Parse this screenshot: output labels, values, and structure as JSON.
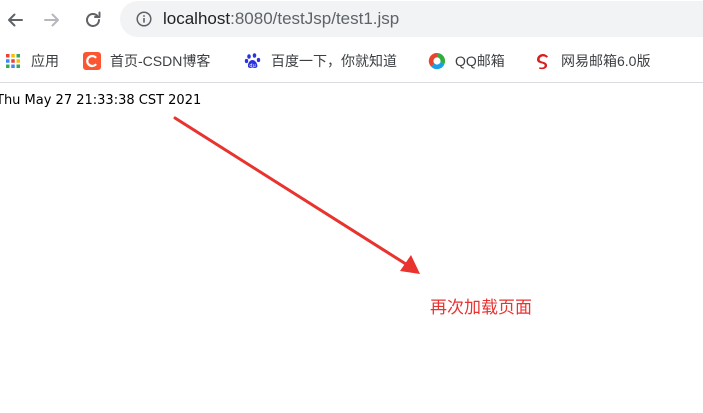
{
  "browser": {
    "url_host": "localhost",
    "url_path": ":8080/testJsp/test1.jsp"
  },
  "bookmarks": [
    {
      "label": "应用",
      "icon": "apps-grid-icon"
    },
    {
      "label": "首页-CSDN博客",
      "icon": "csdn-icon"
    },
    {
      "label": "百度一下，你就知道",
      "icon": "baidu-paw-icon"
    },
    {
      "label": "QQ邮箱",
      "icon": "qq-mail-icon"
    },
    {
      "label": "网易邮箱6.0版",
      "icon": "netease-mail-icon"
    }
  ],
  "page": {
    "date_text": "Thu May 27 21:33:38 CST 2021",
    "annotation": "再次加载页面"
  },
  "colors": {
    "annotation": "#e8332f",
    "csdn": "#fc5531",
    "baidu": "#2932e1"
  }
}
